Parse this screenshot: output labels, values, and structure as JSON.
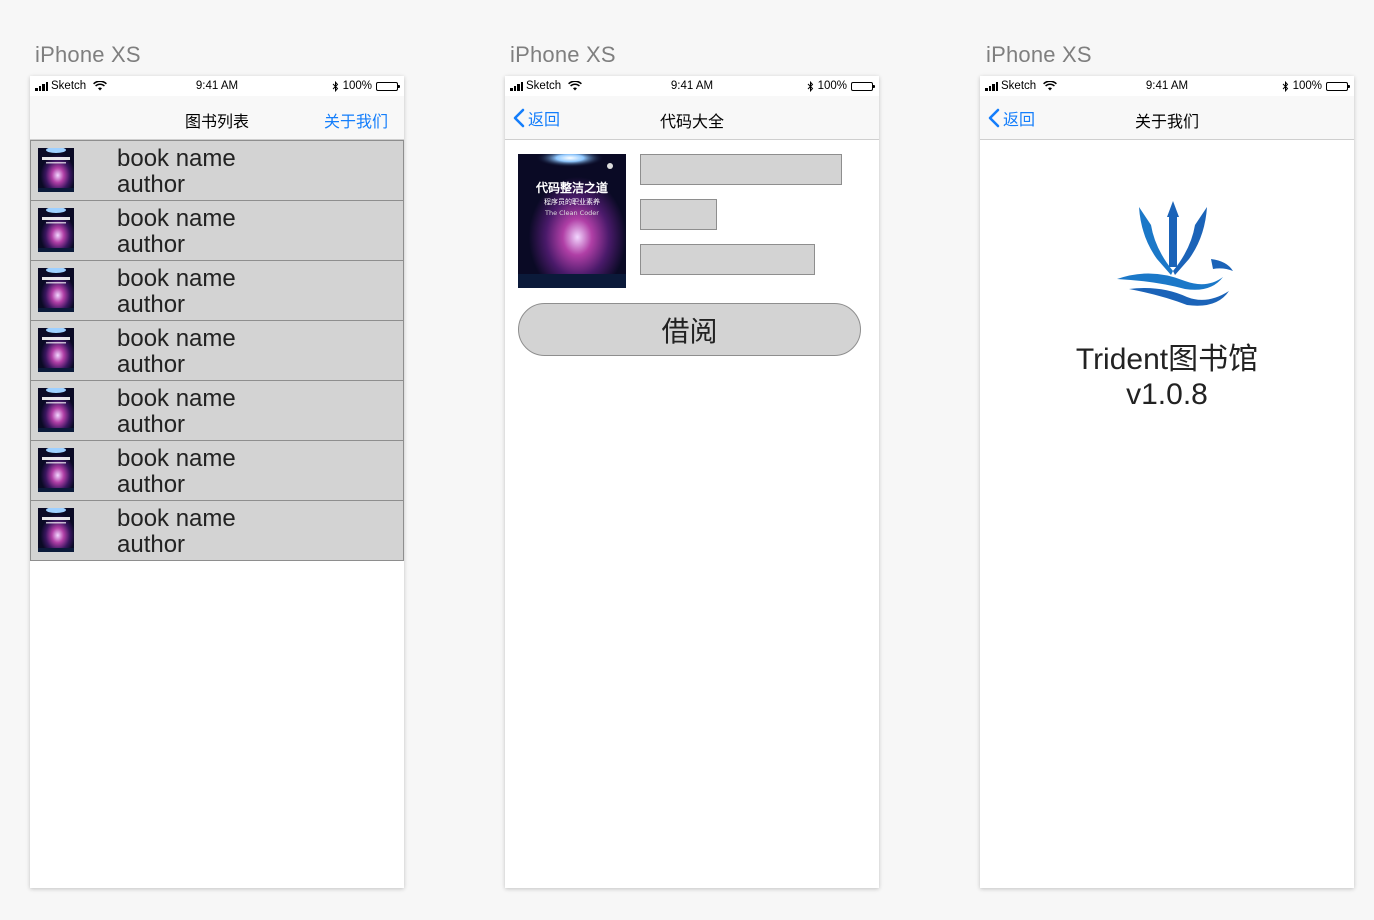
{
  "artboards": [
    {
      "title": "iPhone XS"
    },
    {
      "title": "iPhone XS"
    },
    {
      "title": "iPhone XS"
    }
  ],
  "statusbar": {
    "carrier": "Sketch",
    "time": "9:41 AM",
    "battery": "100%"
  },
  "list_screen": {
    "title": "图书列表",
    "about_link": "关于我们",
    "rows": [
      {
        "name": "book name",
        "author": "author"
      },
      {
        "name": "book name",
        "author": "author"
      },
      {
        "name": "book name",
        "author": "author"
      },
      {
        "name": "book name",
        "author": "author"
      },
      {
        "name": "book name",
        "author": "author"
      },
      {
        "name": "book name",
        "author": "author"
      },
      {
        "name": "book name",
        "author": "author"
      }
    ]
  },
  "cover": {
    "title": "代码整洁之道",
    "subtitle": "程序员的职业素养",
    "english": "The Clean Coder"
  },
  "detail_screen": {
    "back": "返回",
    "title": "代码大全",
    "borrow_button": "借阅"
  },
  "about_screen": {
    "back": "返回",
    "title": "关于我们",
    "app_name": "Trident图书馆",
    "version": "v1.0.8"
  },
  "colors": {
    "ios_blue": "#147efb",
    "placeholder_gray": "#d3d3d3",
    "logo_blue": "#1b63b8"
  }
}
